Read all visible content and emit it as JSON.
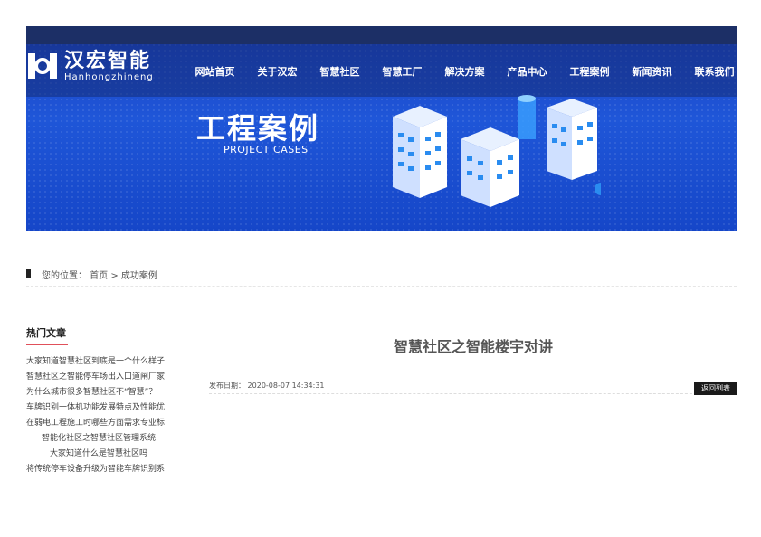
{
  "header": {
    "logo": {
      "cn": "汉宏智能",
      "en": "Hanhongzhineng"
    },
    "nav": [
      "网站首页",
      "关于汉宏",
      "智慧社区",
      "智慧工厂",
      "解决方案",
      "产品中心",
      "工程案例",
      "新闻资讯",
      "联系我们"
    ]
  },
  "banner": {
    "title": "工程案例",
    "subtitle": "PROJECT CASES"
  },
  "breadcrumb": {
    "text": "您的位置： 首页 > 成功案例"
  },
  "sidebar": {
    "title": "热门文章",
    "items": [
      "大家知道智慧社区到底是一个什么样子",
      "智慧社区之智能停车场出入口道闸厂家",
      "为什么城市很多智慧社区不“智慧”？",
      "车牌识别一体机功能发展特点及性能优",
      "在弱电工程施工时哪些方面需求专业标",
      "智能化社区之智慧社区管理系统",
      "大家知道什么是智慧社区吗",
      "将传统停车设备升级为智能车牌识别系"
    ]
  },
  "article": {
    "title": "智慧社区之智能楼宇对讲",
    "date_label": "发布日期：",
    "date": "2020-08-07 14:34:31",
    "back_label": "返回列表"
  }
}
